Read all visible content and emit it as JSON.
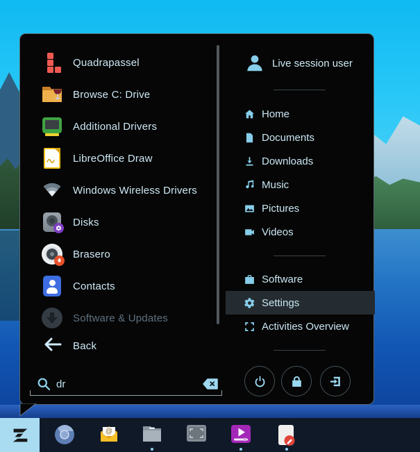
{
  "colors": {
    "accent": "#86cde9",
    "text": "#cde8f4",
    "menu_bg": "#060606",
    "highlight_bg": "#252c31",
    "taskbar_bg": "#101928",
    "zorin_button_bg": "#a9dcf1",
    "dimmed_text": "#5f7280"
  },
  "menu": {
    "apps": [
      {
        "label": "Quadrapassel",
        "icon": "quadrapassel-blocks-icon"
      },
      {
        "label": "Browse C: Drive",
        "icon": "wine-folder-icon"
      },
      {
        "label": "Additional Drivers",
        "icon": "drivers-monitor-icon"
      },
      {
        "label": "LibreOffice Draw",
        "icon": "libreoffice-draw-icon"
      },
      {
        "label": "Windows Wireless Drivers",
        "icon": "wifi-icon"
      },
      {
        "label": "Disks",
        "icon": "disk-utility-icon"
      },
      {
        "label": "Brasero",
        "icon": "disc-burner-icon"
      },
      {
        "label": "Contacts",
        "icon": "contacts-icon"
      },
      {
        "label": "Software & Updates",
        "icon": "software-updates-icon",
        "disabled": true
      }
    ],
    "back_label": "Back",
    "search": {
      "value": "dr",
      "icon": "search-icon",
      "clear_icon": "backspace-clear-icon"
    },
    "user": {
      "name": "Live session user",
      "icon": "user-icon"
    },
    "places": [
      {
        "label": "Home",
        "icon": "home-icon"
      },
      {
        "label": "Documents",
        "icon": "document-icon"
      },
      {
        "label": "Downloads",
        "icon": "download-icon"
      },
      {
        "label": "Music",
        "icon": "music-note-icon"
      },
      {
        "label": "Pictures",
        "icon": "picture-icon"
      },
      {
        "label": "Videos",
        "icon": "video-camera-icon"
      }
    ],
    "system": [
      {
        "label": "Software",
        "icon": "software-bag-icon"
      },
      {
        "label": "Settings",
        "icon": "gear-icon",
        "highlighted": true
      },
      {
        "label": "Activities Overview",
        "icon": "activities-corners-icon"
      }
    ],
    "session_buttons": [
      {
        "icon": "power-icon"
      },
      {
        "icon": "lock-icon"
      },
      {
        "icon": "logout-icon"
      }
    ]
  },
  "taskbar": {
    "items": [
      {
        "icon": "zorin-menu-icon",
        "active": true
      },
      {
        "icon": "browser-icon",
        "running": false
      },
      {
        "icon": "mail-icon",
        "running": false
      },
      {
        "icon": "files-icon",
        "running": true
      },
      {
        "icon": "screenshot-icon",
        "running": false
      },
      {
        "icon": "video-player-icon",
        "running": true
      },
      {
        "icon": "text-editor-icon",
        "running": true
      }
    ]
  }
}
